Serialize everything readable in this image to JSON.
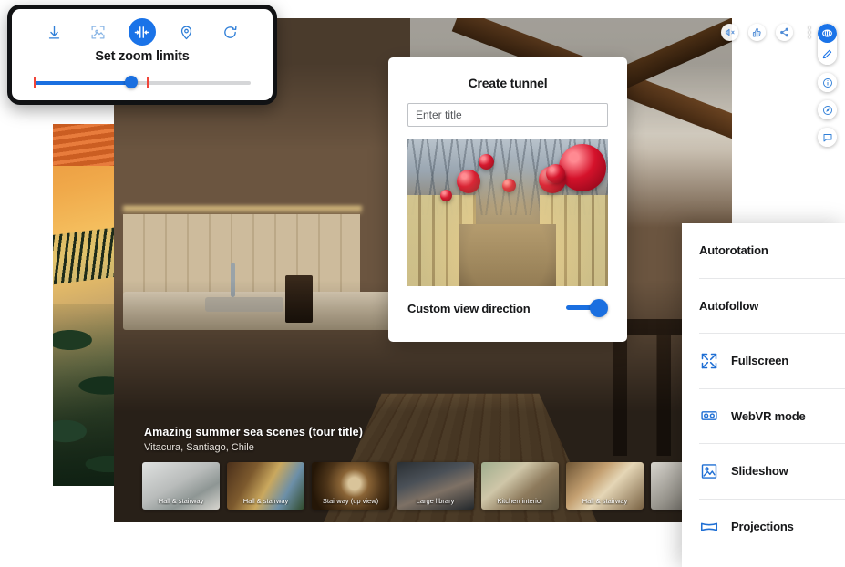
{
  "zoom_panel": {
    "title": "Set zoom limits",
    "tools": [
      {
        "name": "download-icon",
        "glyph": "download"
      },
      {
        "name": "crop-image-icon",
        "glyph": "crop-image"
      },
      {
        "name": "zoom-limits-icon",
        "glyph": "zoom-limits",
        "active": true
      },
      {
        "name": "location-pin-icon",
        "glyph": "pin"
      },
      {
        "name": "rotate-icon",
        "glyph": "rotate"
      }
    ],
    "slider": {
      "min_stop_pct": 0,
      "value_pct": 45,
      "max_stop_pct": 52
    }
  },
  "tunnel_dialog": {
    "title": "Create tunnel",
    "input_placeholder": "Enter title",
    "input_value": "",
    "preview_name": "tunnel-target-preview",
    "toggle_label": "Custom view direction",
    "toggle_on": true
  },
  "viewer": {
    "tour_title": "Amazing summer sea scenes (tour title)",
    "tour_location": "Vitacura, Santiago, Chile",
    "thumbnails": [
      {
        "label": "Hall & stairway"
      },
      {
        "label": "Hall & stairway"
      },
      {
        "label": "Stairway (up view)"
      },
      {
        "label": "Large library"
      },
      {
        "label": "Kitchen interior"
      },
      {
        "label": "Hall & stairway"
      },
      {
        "label": ""
      }
    ],
    "top_icons": [
      {
        "name": "sound-off-icon"
      },
      {
        "name": "like-icon"
      },
      {
        "name": "share-icon"
      },
      {
        "name": "more-options-icon"
      }
    ],
    "right_rail": [
      {
        "name": "vr-view-icon"
      },
      {
        "name": "edit-pencil-icon"
      },
      {
        "name": "info-icon"
      },
      {
        "name": "compass-icon"
      },
      {
        "name": "comment-icon"
      }
    ]
  },
  "context_menu": {
    "items": [
      {
        "label": "Autorotation",
        "icon": ""
      },
      {
        "label": "Autofollow",
        "icon": ""
      },
      {
        "label": "Fullscreen",
        "icon": "fullscreen-icon"
      },
      {
        "label": "WebVR mode",
        "icon": "webvr-icon"
      },
      {
        "label": "Slideshow",
        "icon": "slideshow-icon"
      },
      {
        "label": "Projections",
        "icon": "projections-icon"
      }
    ]
  },
  "colors": {
    "accent": "#1a6fe0",
    "accent_alt": "#1a73e8",
    "stop_marker": "#f0453a",
    "text": "#17181a"
  }
}
